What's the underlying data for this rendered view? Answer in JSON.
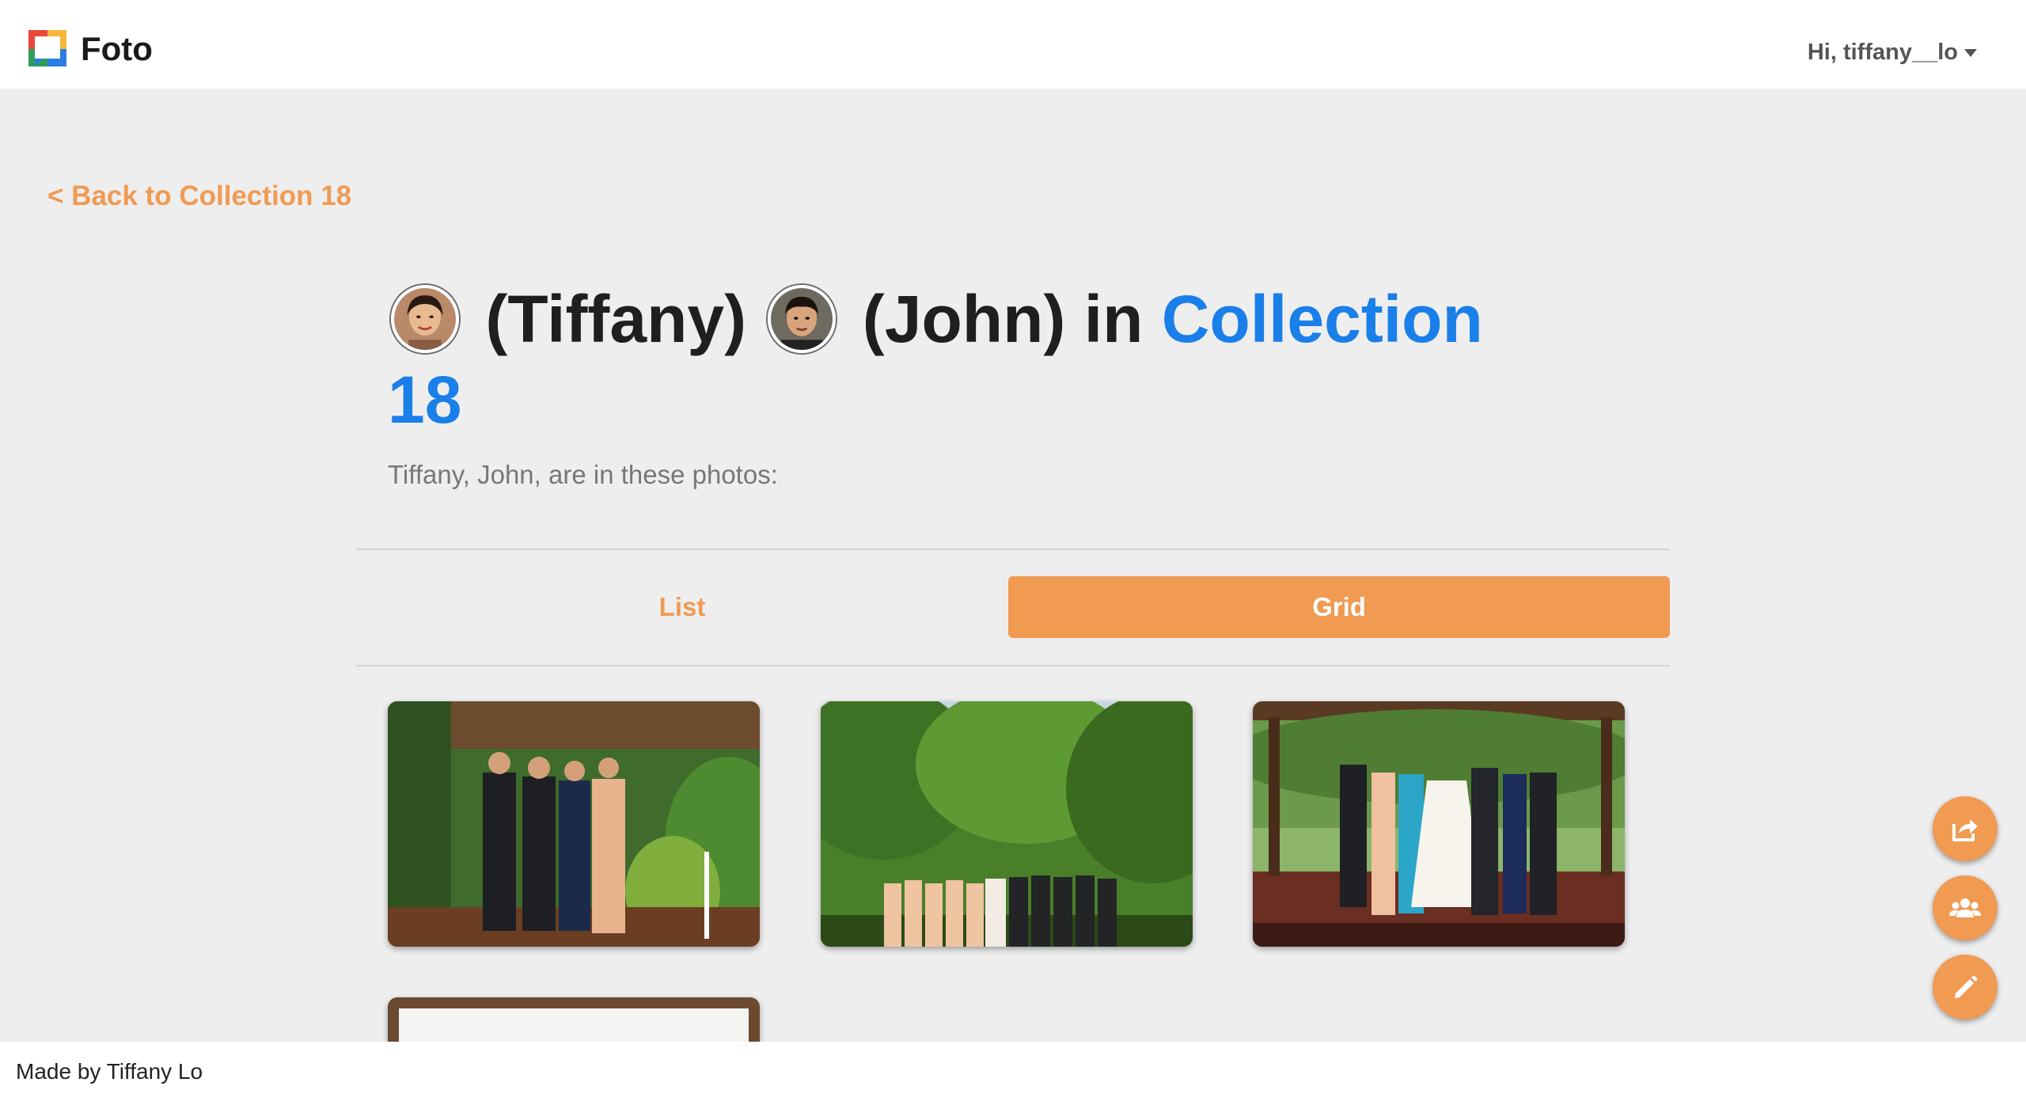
{
  "header": {
    "brand": "Foto",
    "greeting": "Hi, tiffany__lo",
    "logo_icon": "foto-logo-icon",
    "menu_icon": "caret-down-icon"
  },
  "nav": {
    "back_label": "< Back to Collection 18"
  },
  "title": {
    "person1": "(Tiffany)",
    "person2": "(John)",
    "connector": "in",
    "collection": "Collection 18",
    "subtitle": "Tiffany, John, are in these photos:"
  },
  "view_toggle": {
    "list_label": "List",
    "grid_label": "Grid",
    "selected": "Grid"
  },
  "photos": [
    {
      "name": "photo-1",
      "description": "group on porch"
    },
    {
      "name": "photo-2",
      "description": "wedding party in trees"
    },
    {
      "name": "photo-3",
      "description": "family on gazebo"
    },
    {
      "name": "photo-4",
      "description": "partially visible"
    }
  ],
  "footer": {
    "credit": "Made by Tiffany Lo"
  },
  "fabs": [
    {
      "icon": "share-icon"
    },
    {
      "icon": "people-icon"
    },
    {
      "icon": "pencil-icon"
    }
  ],
  "colors": {
    "accent": "#f09a52",
    "link_blue": "#1a7fe8",
    "background": "#eeeeef"
  }
}
